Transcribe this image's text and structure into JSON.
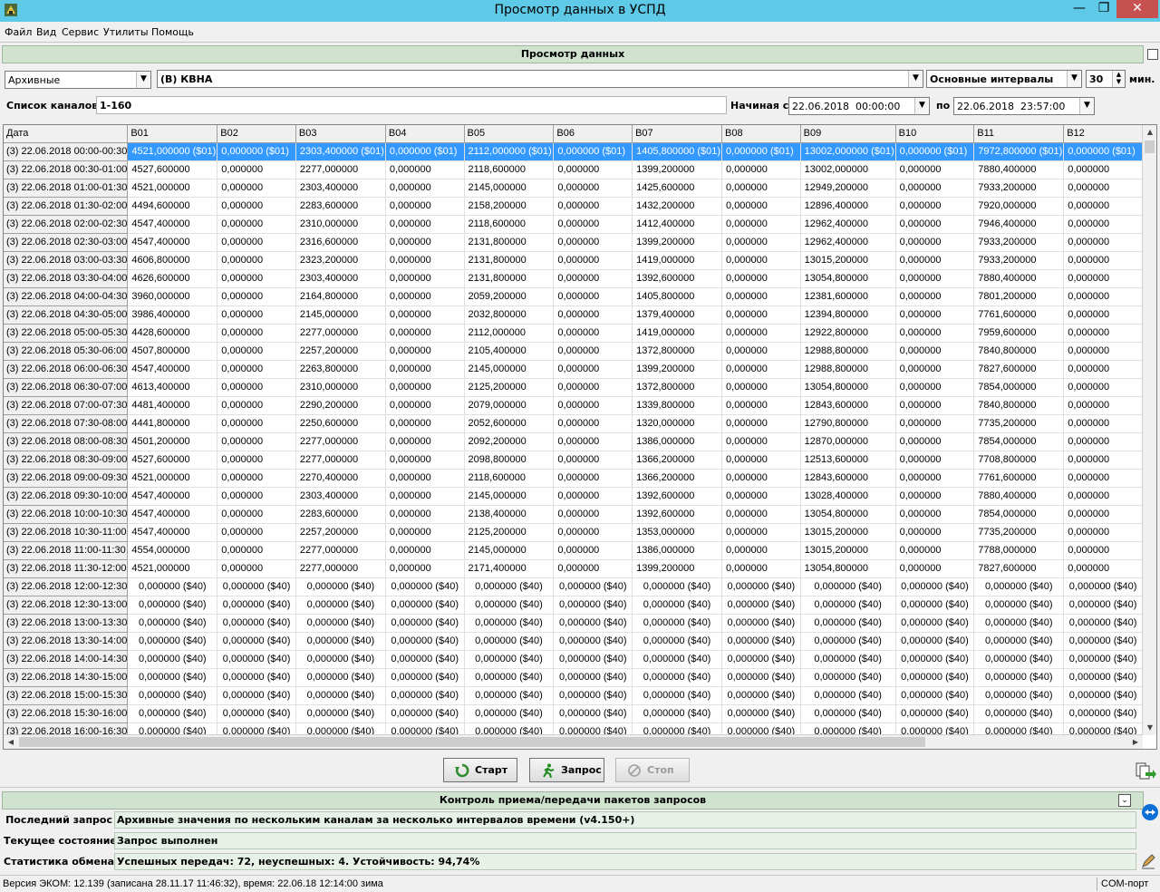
{
  "window": {
    "title": "Просмотр данных в УСПД",
    "min_glyph": "—",
    "max_glyph": "❐",
    "close_glyph": "✕"
  },
  "menu": [
    "Файл",
    "Вид",
    "Сервис",
    "Утилиты",
    "Помощь"
  ],
  "view_panel": {
    "header": "Просмотр данных",
    "mode": "Архивные",
    "object": "(В) КВНА",
    "interval_type": "Основные интервалы",
    "interval_value": "30",
    "interval_unit": "мин.",
    "channels_label": "Список каналов",
    "channels_value": "1-160",
    "from_label": "Начиная с",
    "from_value": "22.06.2018  00:00:00",
    "to_label": "по",
    "to_value": "22.06.2018  23:57:00"
  },
  "grid": {
    "columns": [
      "Дата",
      "В01",
      "В02",
      "В03",
      "В04",
      "В05",
      "В06",
      "В07",
      "В08",
      "В09",
      "В10",
      "В11",
      "В12"
    ],
    "rows": [
      [
        "(3) 22.06.2018 00:00-00:30",
        "4521,000000 ($01)",
        "0,000000 ($01)",
        "2303,400000 ($01)",
        "0,000000 ($01)",
        "2112,000000 ($01)",
        "0,000000 ($01)",
        "1405,800000 ($01)",
        "0,000000 ($01)",
        "13002,000000 ($01)",
        "0,000000 ($01)",
        "7972,800000 ($01)",
        "0,000000 ($01)"
      ],
      [
        "(3) 22.06.2018 00:30-01:00",
        "4527,600000",
        "0,000000",
        "2277,000000",
        "0,000000",
        "2118,600000",
        "0,000000",
        "1399,200000",
        "0,000000",
        "13002,000000",
        "0,000000",
        "7880,400000",
        "0,000000"
      ],
      [
        "(3) 22.06.2018 01:00-01:30",
        "4521,000000",
        "0,000000",
        "2303,400000",
        "0,000000",
        "2145,000000",
        "0,000000",
        "1425,600000",
        "0,000000",
        "12949,200000",
        "0,000000",
        "7933,200000",
        "0,000000"
      ],
      [
        "(3) 22.06.2018 01:30-02:00",
        "4494,600000",
        "0,000000",
        "2283,600000",
        "0,000000",
        "2158,200000",
        "0,000000",
        "1432,200000",
        "0,000000",
        "12896,400000",
        "0,000000",
        "7920,000000",
        "0,000000"
      ],
      [
        "(3) 22.06.2018 02:00-02:30",
        "4547,400000",
        "0,000000",
        "2310,000000",
        "0,000000",
        "2118,600000",
        "0,000000",
        "1412,400000",
        "0,000000",
        "12962,400000",
        "0,000000",
        "7946,400000",
        "0,000000"
      ],
      [
        "(3) 22.06.2018 02:30-03:00",
        "4547,400000",
        "0,000000",
        "2316,600000",
        "0,000000",
        "2131,800000",
        "0,000000",
        "1399,200000",
        "0,000000",
        "12962,400000",
        "0,000000",
        "7933,200000",
        "0,000000"
      ],
      [
        "(3) 22.06.2018 03:00-03:30",
        "4606,800000",
        "0,000000",
        "2323,200000",
        "0,000000",
        "2131,800000",
        "0,000000",
        "1419,000000",
        "0,000000",
        "13015,200000",
        "0,000000",
        "7933,200000",
        "0,000000"
      ],
      [
        "(3) 22.06.2018 03:30-04:00",
        "4626,600000",
        "0,000000",
        "2303,400000",
        "0,000000",
        "2131,800000",
        "0,000000",
        "1392,600000",
        "0,000000",
        "13054,800000",
        "0,000000",
        "7880,400000",
        "0,000000"
      ],
      [
        "(3) 22.06.2018 04:00-04:30",
        "3960,000000",
        "0,000000",
        "2164,800000",
        "0,000000",
        "2059,200000",
        "0,000000",
        "1405,800000",
        "0,000000",
        "12381,600000",
        "0,000000",
        "7801,200000",
        "0,000000"
      ],
      [
        "(3) 22.06.2018 04:30-05:00",
        "3986,400000",
        "0,000000",
        "2145,000000",
        "0,000000",
        "2032,800000",
        "0,000000",
        "1379,400000",
        "0,000000",
        "12394,800000",
        "0,000000",
        "7761,600000",
        "0,000000"
      ],
      [
        "(3) 22.06.2018 05:00-05:30",
        "4428,600000",
        "0,000000",
        "2277,000000",
        "0,000000",
        "2112,000000",
        "0,000000",
        "1419,000000",
        "0,000000",
        "12922,800000",
        "0,000000",
        "7959,600000",
        "0,000000"
      ],
      [
        "(3) 22.06.2018 05:30-06:00",
        "4507,800000",
        "0,000000",
        "2257,200000",
        "0,000000",
        "2105,400000",
        "0,000000",
        "1372,800000",
        "0,000000",
        "12988,800000",
        "0,000000",
        "7840,800000",
        "0,000000"
      ],
      [
        "(3) 22.06.2018 06:00-06:30",
        "4547,400000",
        "0,000000",
        "2263,800000",
        "0,000000",
        "2145,000000",
        "0,000000",
        "1399,200000",
        "0,000000",
        "12988,800000",
        "0,000000",
        "7827,600000",
        "0,000000"
      ],
      [
        "(3) 22.06.2018 06:30-07:00",
        "4613,400000",
        "0,000000",
        "2310,000000",
        "0,000000",
        "2125,200000",
        "0,000000",
        "1372,800000",
        "0,000000",
        "13054,800000",
        "0,000000",
        "7854,000000",
        "0,000000"
      ],
      [
        "(3) 22.06.2018 07:00-07:30",
        "4481,400000",
        "0,000000",
        "2290,200000",
        "0,000000",
        "2079,000000",
        "0,000000",
        "1339,800000",
        "0,000000",
        "12843,600000",
        "0,000000",
        "7840,800000",
        "0,000000"
      ],
      [
        "(3) 22.06.2018 07:30-08:00",
        "4441,800000",
        "0,000000",
        "2250,600000",
        "0,000000",
        "2052,600000",
        "0,000000",
        "1320,000000",
        "0,000000",
        "12790,800000",
        "0,000000",
        "7735,200000",
        "0,000000"
      ],
      [
        "(3) 22.06.2018 08:00-08:30",
        "4501,200000",
        "0,000000",
        "2277,000000",
        "0,000000",
        "2092,200000",
        "0,000000",
        "1386,000000",
        "0,000000",
        "12870,000000",
        "0,000000",
        "7854,000000",
        "0,000000"
      ],
      [
        "(3) 22.06.2018 08:30-09:00",
        "4527,600000",
        "0,000000",
        "2277,000000",
        "0,000000",
        "2098,800000",
        "0,000000",
        "1366,200000",
        "0,000000",
        "12513,600000",
        "0,000000",
        "7708,800000",
        "0,000000"
      ],
      [
        "(3) 22.06.2018 09:00-09:30",
        "4521,000000",
        "0,000000",
        "2270,400000",
        "0,000000",
        "2118,600000",
        "0,000000",
        "1366,200000",
        "0,000000",
        "12843,600000",
        "0,000000",
        "7761,600000",
        "0,000000"
      ],
      [
        "(3) 22.06.2018 09:30-10:00",
        "4547,400000",
        "0,000000",
        "2303,400000",
        "0,000000",
        "2145,000000",
        "0,000000",
        "1392,600000",
        "0,000000",
        "13028,400000",
        "0,000000",
        "7880,400000",
        "0,000000"
      ],
      [
        "(3) 22.06.2018 10:00-10:30",
        "4547,400000",
        "0,000000",
        "2283,600000",
        "0,000000",
        "2138,400000",
        "0,000000",
        "1392,600000",
        "0,000000",
        "13054,800000",
        "0,000000",
        "7854,000000",
        "0,000000"
      ],
      [
        "(3) 22.06.2018 10:30-11:00",
        "4547,400000",
        "0,000000",
        "2257,200000",
        "0,000000",
        "2125,200000",
        "0,000000",
        "1353,000000",
        "0,000000",
        "13015,200000",
        "0,000000",
        "7735,200000",
        "0,000000"
      ],
      [
        "(3) 22.06.2018 11:00-11:30",
        "4554,000000",
        "0,000000",
        "2277,000000",
        "0,000000",
        "2145,000000",
        "0,000000",
        "1386,000000",
        "0,000000",
        "13015,200000",
        "0,000000",
        "7788,000000",
        "0,000000"
      ],
      [
        "(3) 22.06.2018 11:30-12:00",
        "4521,000000",
        "0,000000",
        "2277,000000",
        "0,000000",
        "2171,400000",
        "0,000000",
        "1399,200000",
        "0,000000",
        "13054,800000",
        "0,000000",
        "7827,600000",
        "0,000000"
      ],
      [
        "(3) 22.06.2018 12:00-12:30",
        "0,000000 ($40)",
        "0,000000 ($40)",
        "0,000000 ($40)",
        "0,000000 ($40)",
        "0,000000 ($40)",
        "0,000000 ($40)",
        "0,000000 ($40)",
        "0,000000 ($40)",
        "0,000000 ($40)",
        "0,000000 ($40)",
        "0,000000 ($40)",
        "0,000000 ($40)"
      ],
      [
        "(3) 22.06.2018 12:30-13:00",
        "0,000000 ($40)",
        "0,000000 ($40)",
        "0,000000 ($40)",
        "0,000000 ($40)",
        "0,000000 ($40)",
        "0,000000 ($40)",
        "0,000000 ($40)",
        "0,000000 ($40)",
        "0,000000 ($40)",
        "0,000000 ($40)",
        "0,000000 ($40)",
        "0,000000 ($40)"
      ],
      [
        "(3) 22.06.2018 13:00-13:30",
        "0,000000 ($40)",
        "0,000000 ($40)",
        "0,000000 ($40)",
        "0,000000 ($40)",
        "0,000000 ($40)",
        "0,000000 ($40)",
        "0,000000 ($40)",
        "0,000000 ($40)",
        "0,000000 ($40)",
        "0,000000 ($40)",
        "0,000000 ($40)",
        "0,000000 ($40)"
      ],
      [
        "(3) 22.06.2018 13:30-14:00",
        "0,000000 ($40)",
        "0,000000 ($40)",
        "0,000000 ($40)",
        "0,000000 ($40)",
        "0,000000 ($40)",
        "0,000000 ($40)",
        "0,000000 ($40)",
        "0,000000 ($40)",
        "0,000000 ($40)",
        "0,000000 ($40)",
        "0,000000 ($40)",
        "0,000000 ($40)"
      ],
      [
        "(3) 22.06.2018 14:00-14:30",
        "0,000000 ($40)",
        "0,000000 ($40)",
        "0,000000 ($40)",
        "0,000000 ($40)",
        "0,000000 ($40)",
        "0,000000 ($40)",
        "0,000000 ($40)",
        "0,000000 ($40)",
        "0,000000 ($40)",
        "0,000000 ($40)",
        "0,000000 ($40)",
        "0,000000 ($40)"
      ],
      [
        "(3) 22.06.2018 14:30-15:00",
        "0,000000 ($40)",
        "0,000000 ($40)",
        "0,000000 ($40)",
        "0,000000 ($40)",
        "0,000000 ($40)",
        "0,000000 ($40)",
        "0,000000 ($40)",
        "0,000000 ($40)",
        "0,000000 ($40)",
        "0,000000 ($40)",
        "0,000000 ($40)",
        "0,000000 ($40)"
      ],
      [
        "(3) 22.06.2018 15:00-15:30",
        "0,000000 ($40)",
        "0,000000 ($40)",
        "0,000000 ($40)",
        "0,000000 ($40)",
        "0,000000 ($40)",
        "0,000000 ($40)",
        "0,000000 ($40)",
        "0,000000 ($40)",
        "0,000000 ($40)",
        "0,000000 ($40)",
        "0,000000 ($40)",
        "0,000000 ($40)"
      ],
      [
        "(3) 22.06.2018 15:30-16:00",
        "0,000000 ($40)",
        "0,000000 ($40)",
        "0,000000 ($40)",
        "0,000000 ($40)",
        "0,000000 ($40)",
        "0,000000 ($40)",
        "0,000000 ($40)",
        "0,000000 ($40)",
        "0,000000 ($40)",
        "0,000000 ($40)",
        "0,000000 ($40)",
        "0,000000 ($40)"
      ],
      [
        "(3) 22.06.2018 16:00-16:30",
        "0,000000 ($40)",
        "0,000000 ($40)",
        "0,000000 ($40)",
        "0,000000 ($40)",
        "0,000000 ($40)",
        "0,000000 ($40)",
        "0,000000 ($40)",
        "0,000000 ($40)",
        "0,000000 ($40)",
        "0,000000 ($40)",
        "0,000000 ($40)",
        "0,000000 ($40)"
      ]
    ],
    "selected_row": 0
  },
  "actions": {
    "start": "Старт",
    "query": "Запрос",
    "stop": "Стоп"
  },
  "exchange_panel": {
    "header": "Контроль приема/передачи пакетов запросов",
    "last_query_label": "Последний запрос",
    "last_query_value": "Архивные значения по нескольким каналам за несколько интервалов времени (v4.150+)",
    "state_label": "Текущее состояние",
    "state_value": "Запрос выполнен",
    "stats_label": "Статистика обмена",
    "stats_value": "Успешных передач: 72, неуспешных: 4. Устойчивость: 94,74%"
  },
  "statusbar": {
    "version": "Версия ЭКОМ: 12.139 (записана 28.11.17 11:46:32), время: 22.06.18 12:14:00 зима",
    "port": "COM-порт"
  },
  "colors": {
    "titlebar": "#5fc9e8",
    "selection": "#3399ff",
    "section": "#cfe3cf",
    "close": "#c75050"
  }
}
